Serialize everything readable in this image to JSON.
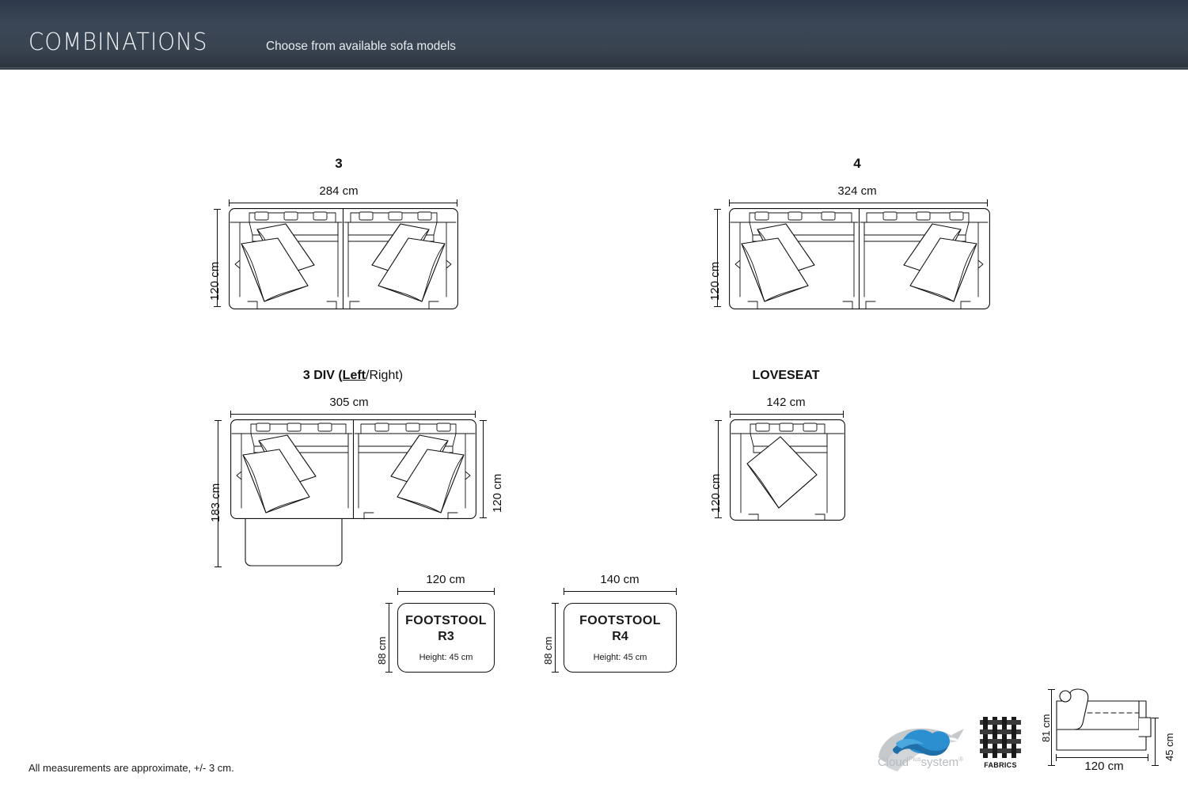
{
  "header": {
    "title": "COMBINATIONS",
    "subtitle": "Choose from available sofa models"
  },
  "models": [
    {
      "id": "three-seater",
      "title": "3",
      "width_label": "284 cm",
      "depth_label": "120 cm"
    },
    {
      "id": "four-seater",
      "title": "4",
      "width_label": "324 cm",
      "depth_label": "120 cm"
    },
    {
      "id": "three-div",
      "title_prefix": "3 DIV (",
      "title_emph": "Left",
      "title_suffix": "/Right)",
      "width_label": "305 cm",
      "depth_label": "183 cm",
      "depth_right_label": "120 cm"
    },
    {
      "id": "loveseat",
      "title": "LOVESEAT",
      "width_label": "142 cm",
      "depth_label": "120 cm"
    }
  ],
  "footstools": [
    {
      "id": "r3",
      "name": "FOOTSTOOL",
      "code": "R3",
      "height_label": "Height: 45 cm",
      "width_label": "120 cm",
      "depth_label": "88 cm"
    },
    {
      "id": "r4",
      "name": "FOOTSTOOL",
      "code": "R4",
      "height_label": "Height: 45 cm",
      "width_label": "140 cm",
      "depth_label": "88 cm"
    }
  ],
  "side_profile": {
    "height_label": "81 cm",
    "seat_height_label": "45 cm",
    "width_label": "120 cm"
  },
  "logos": {
    "cloud_name": "Cloud",
    "cloud_sup": "Plus",
    "cloud_suffix": "system",
    "cloud_reg": "®",
    "fabrics_label": "FABRICS"
  },
  "footer": {
    "disclaimer": "All measurements are approximate, +/- 3 cm."
  },
  "colors": {
    "header_top": "#2d394a",
    "header_bottom": "#2b333d",
    "line": "#111111",
    "cloud_blue": "#2b8fd0",
    "cloud_gray": "#b9bcbf"
  }
}
